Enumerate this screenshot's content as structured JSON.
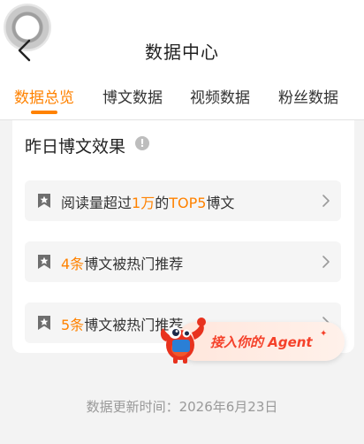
{
  "header": {
    "title": "数据中心"
  },
  "tabs": [
    {
      "label": "数据总览",
      "active": true
    },
    {
      "label": "博文数据",
      "active": false
    },
    {
      "label": "视频数据",
      "active": false
    },
    {
      "label": "粉丝数据",
      "active": false
    }
  ],
  "card": {
    "title": "昨日博文效果",
    "info_icon": "info-icon",
    "rows": [
      {
        "icon": "bookmark-icon",
        "prefix": "阅读量超过",
        "highlight1": "1万",
        "middle": "的",
        "highlight2": "TOP5",
        "suffix": "博文"
      },
      {
        "icon": "bookmark-icon",
        "highlight": "4条",
        "suffix": "博文被热门推荐"
      },
      {
        "icon": "bookmark-icon",
        "highlight": "5条",
        "suffix": "博文被热门推荐"
      }
    ]
  },
  "agent_banner": {
    "label": "接入你的 Agent"
  },
  "footer": {
    "update_time": "数据更新时间：2026年6月23日"
  },
  "colors": {
    "accent": "#ff8200",
    "agent_red": "#f5412a"
  }
}
